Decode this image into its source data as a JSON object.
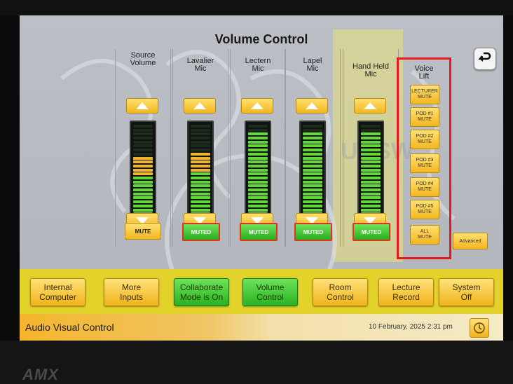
{
  "screen": {
    "title": "Volume Control",
    "channels": [
      {
        "label": "Source\nVolume",
        "mute_label": "MUTE",
        "muted": false,
        "level": 0.7,
        "peak": 0.2
      },
      {
        "label": "Lavalier\nMic",
        "mute_label": "MUTED",
        "muted": true,
        "level": 0.72,
        "peak": 0.18
      },
      {
        "label": "Lectern\nMic",
        "mute_label": "MUTED",
        "muted": true,
        "level": 0.93,
        "peak": 0
      },
      {
        "label": "Lapel\nMic",
        "mute_label": "MUTED",
        "muted": true,
        "level": 0.93,
        "peak": 0
      },
      {
        "label": "Hand Held\nMic",
        "mute_label": "MUTED",
        "muted": true,
        "level": 0.93,
        "peak": 0
      }
    ],
    "voice_lift": {
      "label": "Voice\nLift",
      "buttons": [
        "LECTURER\nMUTE",
        "POD #1\nMUTE",
        "POD #2\nMUTE",
        "POD #3\nMUTE",
        "POD #4\nMUTE",
        "POD #5\nMUTE",
        "ALL\nMUTE"
      ]
    },
    "advanced_label": "Advanced",
    "watermark_text": "UNSW"
  },
  "nav": [
    {
      "label": "Internal\nComputer",
      "active": false
    },
    {
      "label": "More\nInputs",
      "active": false
    },
    {
      "label": "Collaborate\nMode is On",
      "active": true
    },
    {
      "label": "Volume\nControl",
      "active": true
    },
    {
      "label": "Room\nControl",
      "active": false
    },
    {
      "label": "Lecture\nRecord",
      "active": false
    },
    {
      "label": "System\nOff",
      "active": false
    }
  ],
  "status": {
    "title": "Audio Visual Control",
    "datetime": "10 February, 2025  2:31 pm"
  },
  "brand": {
    "logo_text": "AMX"
  },
  "colors": {
    "accent_yellow": "#f3b71e",
    "active_green": "#2bb120",
    "muted_border": "#e0341f",
    "highlight_red": "#e8171c",
    "meter_green": "#63d63a",
    "meter_peak": "#f1b62a"
  },
  "icons": {
    "back": "return-arrow-icon",
    "clock": "clock-icon",
    "up": "triangle-up-icon",
    "down": "triangle-down-icon"
  }
}
